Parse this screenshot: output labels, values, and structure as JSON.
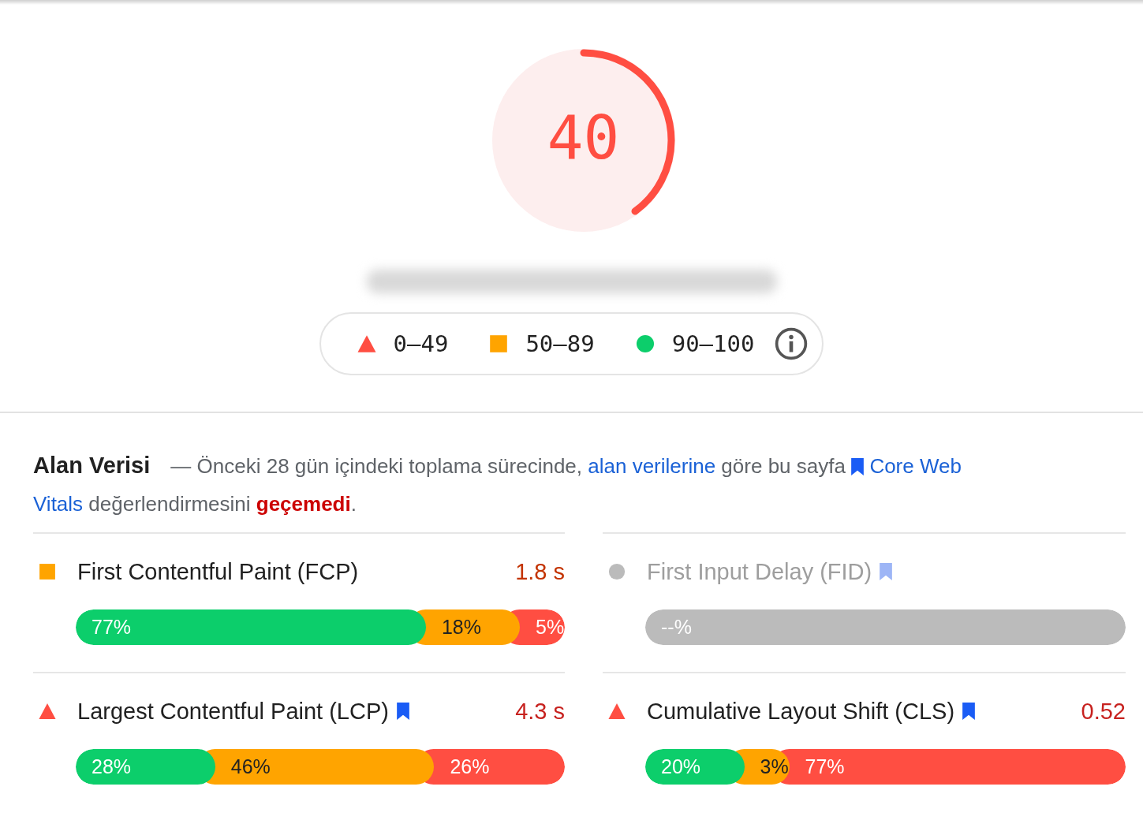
{
  "score": {
    "value": "40",
    "kind": "poor"
  },
  "legend": [
    {
      "kind": "poor",
      "label": "0–49"
    },
    {
      "kind": "average",
      "label": "50–89"
    },
    {
      "kind": "good",
      "label": "90–100"
    }
  ],
  "field_data": {
    "title": "Alan Verisi",
    "text": "— Önceki 28 gün içindeki toplama sürecinde, ",
    "link": "alan verilerine",
    "text_2": " göre bu sayfa ",
    "link_2": "Core Web",
    "link_3": "Vitals",
    "text_3": " değerlendirmesini ",
    "verdict": "geçemedi",
    "text_4": "."
  },
  "metrics": [
    {
      "name": "First Contentful Paint (FCP)",
      "kind": "average",
      "bookmark": false,
      "disabled": false,
      "value": "1.8 s",
      "segments": [
        {
          "kind": "good",
          "label": "77%"
        },
        {
          "kind": "average",
          "label": "18%"
        },
        {
          "kind": "poor",
          "label": "5%"
        }
      ]
    },
    {
      "name": "First Input Delay (FID)",
      "kind": "none",
      "bookmark": true,
      "disabled": true,
      "segments": [
        {
          "kind": "none",
          "label": "--%"
        }
      ]
    },
    {
      "name": "Largest Contentful Paint (LCP)",
      "kind": "poor",
      "bookmark": true,
      "disabled": false,
      "value": "4.3 s",
      "segments": [
        {
          "kind": "good",
          "label": "28%"
        },
        {
          "kind": "average",
          "label": "46%"
        },
        {
          "kind": "poor",
          "label": "26%"
        }
      ]
    },
    {
      "name": "Cumulative Layout Shift (CLS)",
      "kind": "poor",
      "bookmark": true,
      "disabled": false,
      "value": "0.52",
      "segments": [
        {
          "kind": "good",
          "label": "20%"
        },
        {
          "kind": "average",
          "label": "3%"
        },
        {
          "kind": "poor",
          "label": "77%"
        }
      ]
    }
  ]
}
